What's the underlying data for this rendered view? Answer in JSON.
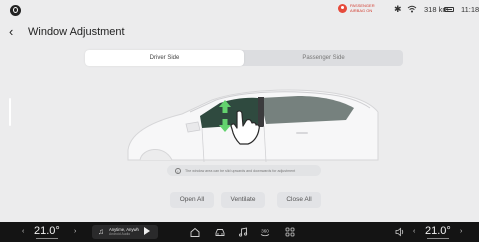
{
  "status_bar": {
    "airbag_text": "PASSENGER AIRBAG ON",
    "range": "318 km",
    "time": "11:18"
  },
  "header": {
    "title": "Window Adjustment"
  },
  "tabs": [
    {
      "label": "Driver Side",
      "selected": true
    },
    {
      "label": "Passenger Side",
      "selected": false
    }
  ],
  "notice": {
    "text": "The window area can be slid upwards and downwards for adjustment"
  },
  "actions": {
    "open_all": "Open All",
    "ventilate": "Ventilate",
    "close_all": "Close All"
  },
  "dock": {
    "temp_left": "21.0°",
    "temp_right": "21.0°",
    "media": {
      "title": "Anytime, Anywh",
      "artist": "Android Audio"
    },
    "icons": [
      "home-icon",
      "car-icon",
      "music-icon",
      "360-camera-icon",
      "apps-grid-icon",
      "volume-icon"
    ]
  },
  "colors": {
    "accent_green": "#63d26e",
    "airbag_red": "#e64a3b",
    "window_tint": "#2f4a3f"
  }
}
